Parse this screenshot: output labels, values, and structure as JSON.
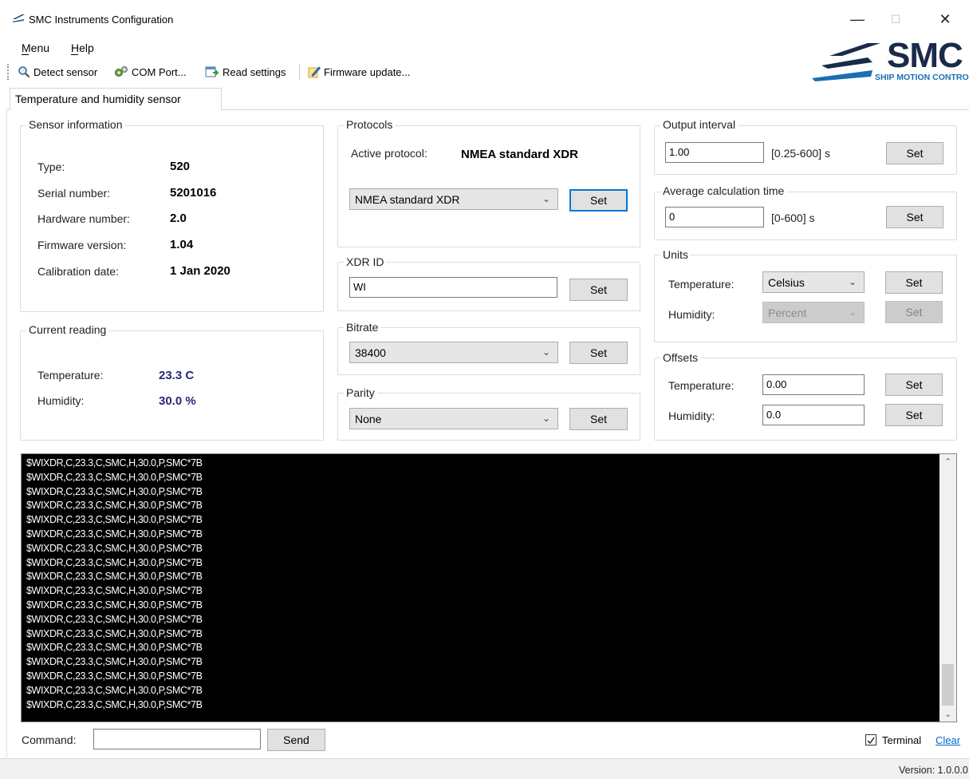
{
  "window": {
    "title": "SMC Instruments Configuration",
    "minimize": "—",
    "maximize": "☐",
    "close": "✕"
  },
  "menu": {
    "menu_label": "Menu",
    "help_label": "Help"
  },
  "toolbar": {
    "detect": "Detect sensor",
    "com_port": "COM Port...",
    "read_settings": "Read settings",
    "firmware": "Firmware update..."
  },
  "logo": {
    "name": "SMC",
    "tagline": "SHIP MOTION CONTROL"
  },
  "tab": {
    "label": "Temperature and humidity sensor"
  },
  "sensor_info": {
    "title": "Sensor information",
    "type_label": "Type:",
    "type_value": "520",
    "serial_label": "Serial number:",
    "serial_value": "5201016",
    "hardware_label": "Hardware number:",
    "hardware_value": "2.0",
    "firmware_label": "Firmware version:",
    "firmware_value": "1.04",
    "calibration_label": "Calibration date:",
    "calibration_value": "1 Jan 2020"
  },
  "current_reading": {
    "title": "Current reading",
    "temperature_label": "Temperature:",
    "temperature_value": "23.3 C",
    "humidity_label": "Humidity:",
    "humidity_value": "30.0 %"
  },
  "protocols": {
    "title": "Protocols",
    "active_label": "Active protocol:",
    "active_value": "NMEA standard XDR",
    "selected": "NMEA standard XDR",
    "set": "Set"
  },
  "xdr_id": {
    "title": "XDR ID",
    "value": "WI",
    "set": "Set"
  },
  "bitrate": {
    "title": "Bitrate",
    "selected": "38400",
    "set": "Set"
  },
  "parity": {
    "title": "Parity",
    "selected": "None",
    "set": "Set"
  },
  "output_interval": {
    "title": "Output interval",
    "value": "1.00",
    "range": "[0.25-600] s",
    "set": "Set"
  },
  "average_time": {
    "title": "Average calculation time",
    "value": "0",
    "range": "[0-600] s",
    "set": "Set"
  },
  "units": {
    "title": "Units",
    "temperature_label": "Temperature:",
    "temperature_selected": "Celsius",
    "humidity_label": "Humidity:",
    "humidity_selected": "Percent",
    "set": "Set"
  },
  "offsets": {
    "title": "Offsets",
    "temperature_label": "Temperature:",
    "temperature_value": "0.00",
    "humidity_label": "Humidity:",
    "humidity_value": "0.0",
    "set": "Set"
  },
  "terminal": {
    "lines": [
      "$WIXDR,C,23.3,C,SMC,H,30.0,P,SMC*7B",
      "$WIXDR,C,23.3,C,SMC,H,30.0,P,SMC*7B",
      "$WIXDR,C,23.3,C,SMC,H,30.0,P,SMC*7B",
      "$WIXDR,C,23.3,C,SMC,H,30.0,P,SMC*7B",
      "$WIXDR,C,23.3,C,SMC,H,30.0,P,SMC*7B",
      "$WIXDR,C,23.3,C,SMC,H,30.0,P,SMC*7B",
      "$WIXDR,C,23.3,C,SMC,H,30.0,P,SMC*7B",
      "$WIXDR,C,23.3,C,SMC,H,30.0,P,SMC*7B",
      "$WIXDR,C,23.3,C,SMC,H,30.0,P,SMC*7B",
      "$WIXDR,C,23.3,C,SMC,H,30.0,P,SMC*7B",
      "$WIXDR,C,23.3,C,SMC,H,30.0,P,SMC*7B",
      "$WIXDR,C,23.3,C,SMC,H,30.0,P,SMC*7B",
      "$WIXDR,C,23.3,C,SMC,H,30.0,P,SMC*7B",
      "$WIXDR,C,23.3,C,SMC,H,30.0,P,SMC*7B",
      "$WIXDR,C,23.3,C,SMC,H,30.0,P,SMC*7B",
      "$WIXDR,C,23.3,C,SMC,H,30.0,P,SMC*7B",
      "$WIXDR,C,23.3,C,SMC,H,30.0,P,SMC*7B",
      "$WIXDR,C,23.3,C,SMC,H,30.0,P,SMC*7B"
    ]
  },
  "command": {
    "label": "Command:",
    "value": "",
    "send": "Send"
  },
  "terminal_toggle": {
    "label": "Terminal",
    "checked": true,
    "clear": "Clear"
  },
  "status": {
    "version": "Version: 1.0.0.0"
  },
  "colors": {
    "accent_focus": "#0078d7",
    "reading_value": "#28287c",
    "logo_blue": "#1a6fb3",
    "logo_dark": "#1a2a4a"
  }
}
